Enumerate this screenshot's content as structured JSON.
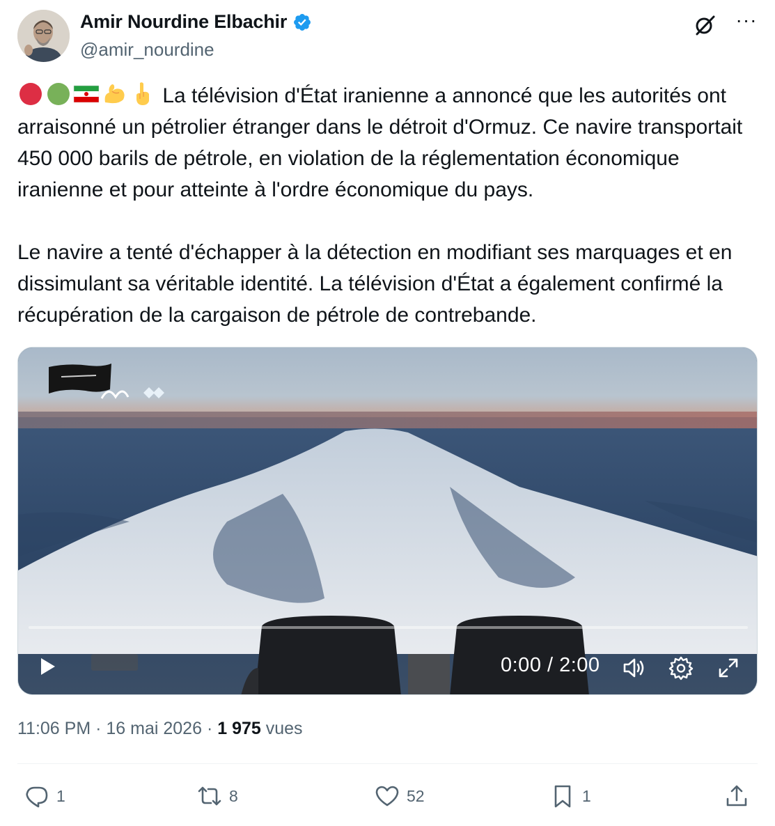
{
  "author": {
    "name": "Amir Nourdine Elbachir",
    "handle": "@amir_nourdine",
    "verified": true,
    "verified_color": "#1d9bf0"
  },
  "tweet": {
    "paragraph_1": "La télévision d'État iranienne a annoncé que les autorités ont arraisonné un pétrolier étranger dans le détroit d'Ormuz. Ce navire transportait 450 000 barils de pétrole, en violation de la réglementation économique iranienne et pour atteinte à l'ordre économique du pays.",
    "paragraph_2": "Le navire a tenté d'échapper à la détection en modifiant ses marquages et en dissimulant sa véritable identité. La télévision d'État a également confirmé la récupération de la cargaison de pétrole de contrebande.",
    "leading_emojis": [
      "red-circle-emoji",
      "green-circle-emoji",
      "iran-flag-emoji",
      "flexed-biceps-emoji",
      "index-pointing-up-emoji"
    ]
  },
  "video": {
    "time": "0:00 / 2:00",
    "progress": 0,
    "controls": [
      "play-icon",
      "volume-icon",
      "settings-icon",
      "fullscreen-icon"
    ]
  },
  "meta": {
    "time": "11:06 PM",
    "separator": "·",
    "date": "16 mai 2026",
    "views_count": "1 975",
    "views_label": "vues"
  },
  "actions": {
    "replies": "1",
    "reposts": "8",
    "likes": "52",
    "bookmarks": "1"
  },
  "colors": {
    "text_primary": "#0f1419",
    "text_secondary": "#536471",
    "divider": "#eff3f4"
  }
}
